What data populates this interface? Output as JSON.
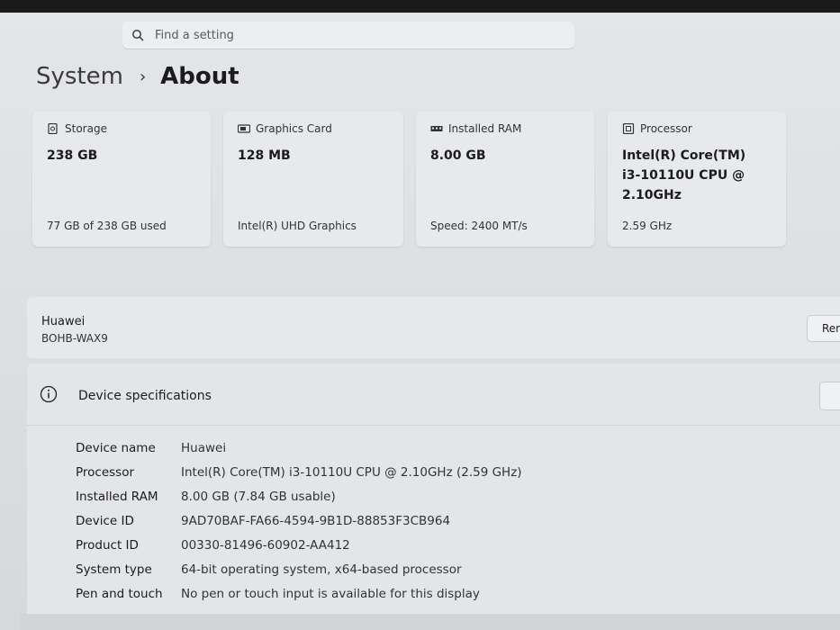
{
  "search": {
    "placeholder": "Find a setting"
  },
  "breadcrumb": {
    "parent": "System",
    "separator": "›",
    "current": "About"
  },
  "cards": [
    {
      "label": "Storage",
      "value": "238 GB",
      "sub": "77 GB of 238 GB used",
      "icon": "storage-icon"
    },
    {
      "label": "Graphics Card",
      "value": "128 MB",
      "sub": "Intel(R) UHD Graphics",
      "icon": "graphics-card-icon"
    },
    {
      "label": "Installed RAM",
      "value": "8.00 GB",
      "sub": "Speed: 2400 MT/s",
      "icon": "ram-icon"
    },
    {
      "label": "Processor",
      "value": "Intel(R) Core(TM) i3-10110U CPU @ 2.10GHz",
      "sub": "2.59 GHz",
      "icon": "processor-icon"
    }
  ],
  "device": {
    "name": "Huawei",
    "model": "BOHB-WAX9",
    "rename_label": "Ren"
  },
  "specs": {
    "title": "Device specifications",
    "rows": [
      {
        "key": "Device name",
        "value": "Huawei"
      },
      {
        "key": "Processor",
        "value": "Intel(R) Core(TM) i3-10110U CPU @ 2.10GHz (2.59 GHz)"
      },
      {
        "key": "Installed RAM",
        "value": "8.00 GB (7.84 GB usable)"
      },
      {
        "key": "Device ID",
        "value": "9AD70BAF-FA66-4594-9B1D-88853F3CB964"
      },
      {
        "key": "Product ID",
        "value": "00330-81496-60902-AA412"
      },
      {
        "key": "System type",
        "value": "64-bit operating system, x64-based processor"
      },
      {
        "key": "Pen and touch",
        "value": "No pen or touch input is available for this display"
      }
    ]
  }
}
